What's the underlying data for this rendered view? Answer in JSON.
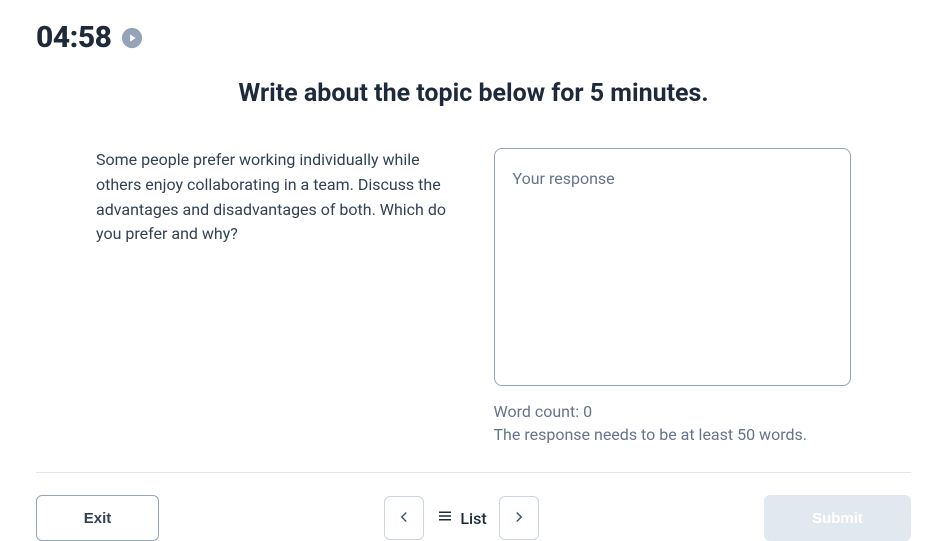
{
  "timer": {
    "value": "04:58"
  },
  "heading": "Write about the topic below for 5 minutes.",
  "prompt": {
    "text": "Some people prefer working individually while others enjoy collaborating in a team. Discuss the advantages and disadvantages of both. Which do you prefer and why?"
  },
  "response": {
    "placeholder": "Your response",
    "value": ""
  },
  "word_count": {
    "label": "Word count: 0"
  },
  "validation": {
    "text": "The response needs to be at least 50 words."
  },
  "footer": {
    "exit_label": "Exit",
    "list_label": "List",
    "submit_label": "Submit"
  }
}
